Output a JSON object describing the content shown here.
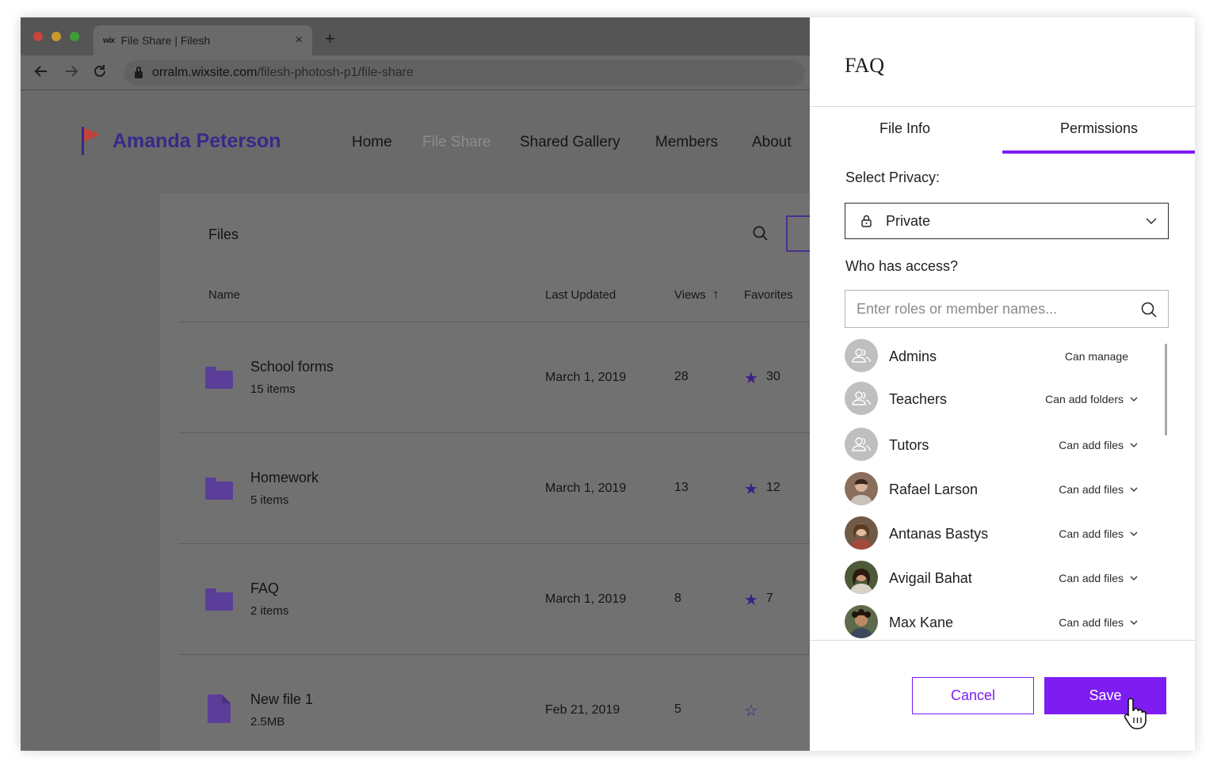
{
  "browser": {
    "tab_favicon": "wix",
    "tab_title": "File Share | Filesh",
    "tab_close": "×",
    "new_tab": "+",
    "url_host": "orralm.wixsite.com",
    "url_path": "/filesh-photosh-p1/file-share"
  },
  "site": {
    "brand": "Amanda Peterson",
    "nav": [
      "Home",
      "File Share",
      "Shared Gallery",
      "Members",
      "About"
    ],
    "active_nav": "File Share"
  },
  "files": {
    "title": "Files",
    "columns": [
      "Name",
      "Last Updated",
      "Views",
      "Favorites"
    ],
    "sort_arrow": "↑",
    "rows": [
      {
        "name": "School forms",
        "sub": "15 items",
        "date": "March 1, 2019",
        "views": "28",
        "favorites": "30",
        "type": "folder",
        "starred": true
      },
      {
        "name": "Homework",
        "sub": "5 items",
        "date": "March 1, 2019",
        "views": "13",
        "favorites": "12",
        "type": "folder",
        "starred": true
      },
      {
        "name": "FAQ",
        "sub": "2 items",
        "date": "March 1, 2019",
        "views": "8",
        "favorites": "7",
        "type": "folder",
        "starred": true
      },
      {
        "name": "New file 1",
        "sub": "2.5MB",
        "date": "Feb 21, 2019",
        "views": "5",
        "favorites": "",
        "type": "file",
        "starred": false
      }
    ]
  },
  "modal": {
    "title": "FAQ",
    "tabs": [
      "File Info",
      "Permissions"
    ],
    "active_tab": "Permissions",
    "privacy_label": "Select Privacy:",
    "privacy_value": "Private",
    "access_label": "Who has access?",
    "search_placeholder": "Enter roles or member names...",
    "members": [
      {
        "name": "Admins",
        "permission": "Can manage",
        "kind": "group",
        "dropdown": false
      },
      {
        "name": "Teachers",
        "permission": "Can add folders",
        "kind": "group",
        "dropdown": true
      },
      {
        "name": "Tutors",
        "permission": "Can add files",
        "kind": "group",
        "dropdown": true
      },
      {
        "name": "Rafael Larson",
        "permission": "Can add files",
        "kind": "person",
        "dropdown": true
      },
      {
        "name": "Antanas Bastys",
        "permission": "Can add files",
        "kind": "person",
        "dropdown": true
      },
      {
        "name": "Avigail Bahat",
        "permission": "Can add files",
        "kind": "person",
        "dropdown": true
      },
      {
        "name": "Max Kane",
        "permission": "Can add files",
        "kind": "person",
        "dropdown": true
      }
    ],
    "cancel_label": "Cancel",
    "save_label": "Save"
  },
  "colors": {
    "accent": "#7d1df2",
    "brand": "#362a8a",
    "folder": "#5b3e99"
  }
}
